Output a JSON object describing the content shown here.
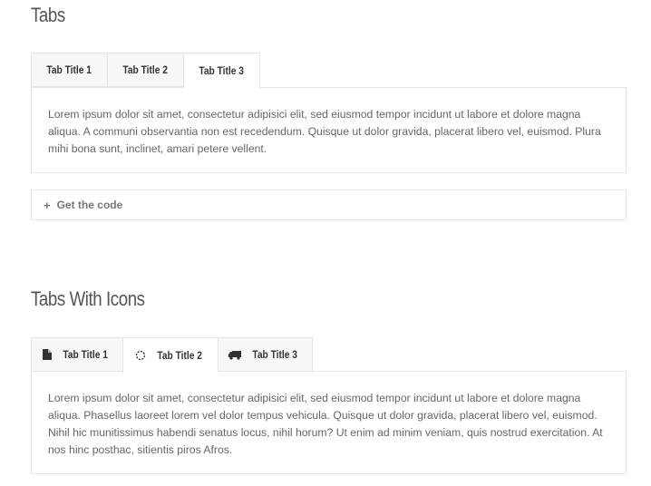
{
  "section1": {
    "title": "Tabs",
    "tabs": [
      {
        "label": "Tab Title 1"
      },
      {
        "label": "Tab Title 2"
      },
      {
        "label": "Tab Title 3"
      }
    ],
    "active_tab": 2,
    "content": "Lorem ipsum dolor sit amet, consectetur adipisici elit, sed eiusmod tempor incidunt ut labore et dolore magna aliqua. A communi observantia non est recedendum. Quisque ut dolor gravida, placerat libero vel, euismod. Plura mihi bona sunt, inclinet, amari petere vellent.",
    "code_toggle": {
      "icon": "+",
      "label": "Get the code"
    }
  },
  "section2": {
    "title": "Tabs With Icons",
    "tabs": [
      {
        "label": "Tab Title 1",
        "icon": "file-icon"
      },
      {
        "label": "Tab Title 2",
        "icon": "spinner-icon"
      },
      {
        "label": "Tab Title 3",
        "icon": "truck-icon"
      }
    ],
    "active_tab": 1,
    "content": "Lorem ipsum dolor sit amet, consectetur adipisici elit, sed eiusmod tempor incidunt ut labore et dolore magna aliqua. Phasellus laoreet lorem vel dolor tempus vehicula. Quisque ut dolor gravida, placerat libero vel, euismod. Nihil hic munitissimus habendi senatus locus, nihil horum? Ut enim ad minim veniam, quis nostrud exercitation. At nos hinc posthac, sitientis piros Afros."
  }
}
